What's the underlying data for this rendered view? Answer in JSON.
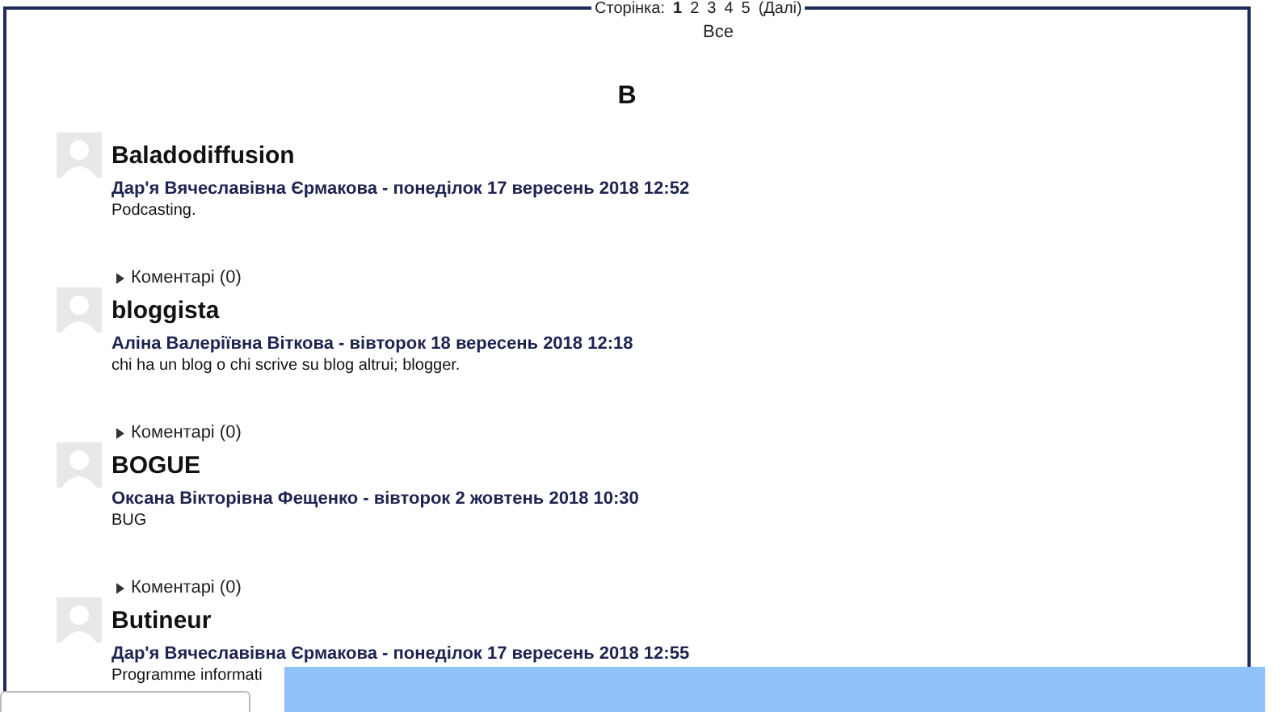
{
  "pagination": {
    "label": "Сторінка:",
    "pages": [
      {
        "label": "1",
        "selected": true
      },
      {
        "label": "2",
        "selected": false
      },
      {
        "label": "3",
        "selected": false
      },
      {
        "label": "4",
        "selected": false
      },
      {
        "label": "5",
        "selected": false
      }
    ],
    "next": "(Далі)",
    "all": "Все"
  },
  "letter": "B",
  "entries": [
    {
      "title": "Baladodiffusion",
      "byline": "Дар'я Вячеславівна Єрмакова - понеділок 17 вересень 2018 12:52",
      "text": "Podcasting.",
      "comments": "Коментарі (0)"
    },
    {
      "title": "bloggista",
      "byline": "Аліна Валеріївна Віткова - вівторок 18 вересень 2018 12:18",
      "text": "chi ha un blog o chi scrive su blog altrui; blogger.",
      "comments": "Коментарі (0)"
    },
    {
      "title": "BOGUE",
      "byline": "Оксана Вікторівна Фещенко - вівторок 2 жовтень 2018 10:30",
      "text": "BUG",
      "comments": "Коментарі (0)"
    },
    {
      "title": "Butineur",
      "byline": "Дар'я Вячеславівна Єрмакова - понеділок 17 вересень 2018 12:55",
      "text": "Programme informati"
    }
  ]
}
